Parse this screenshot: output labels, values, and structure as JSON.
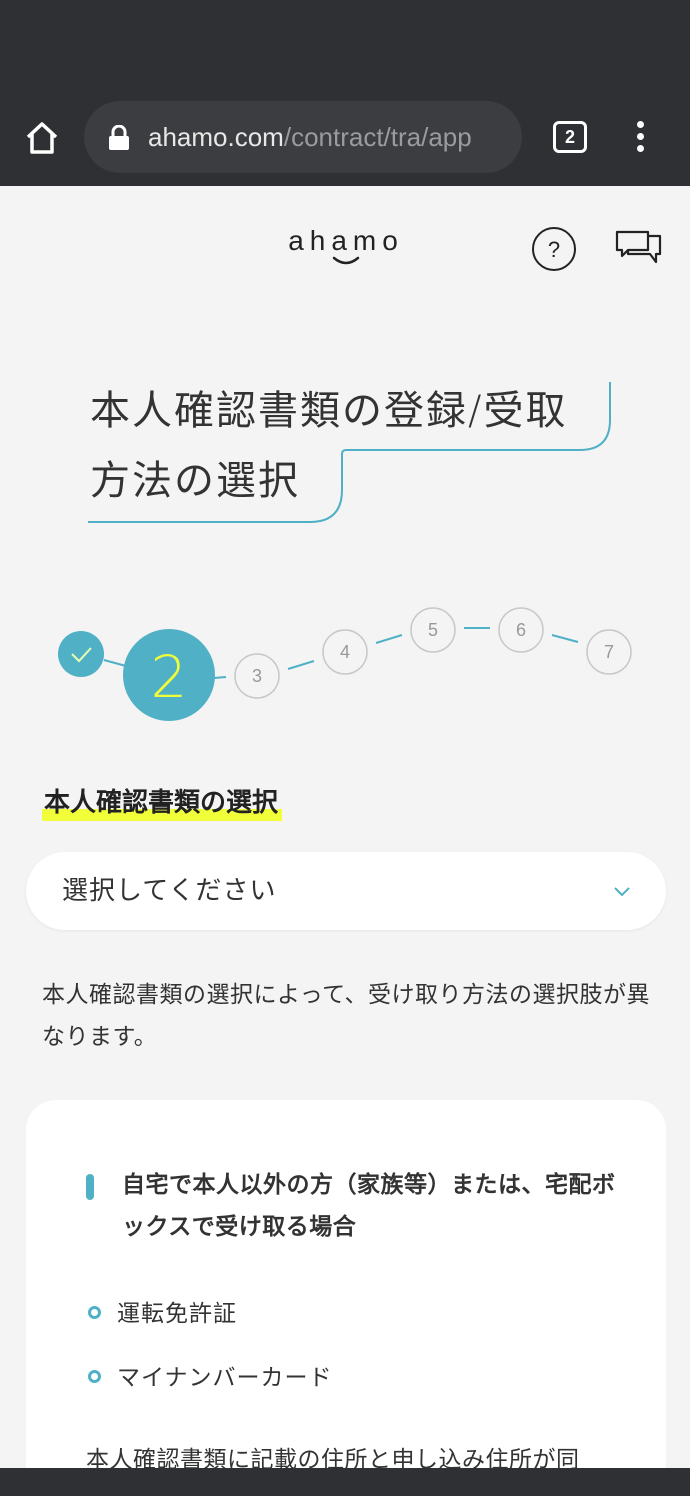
{
  "browser": {
    "url_host": "ahamo.com",
    "url_path": "/contract/tra/app",
    "tab_count": "2"
  },
  "header": {
    "logo": "ahamo",
    "help_label": "?"
  },
  "page": {
    "heading_line1": "本人確認書類の登録/受取",
    "heading_line2": "方法の選択"
  },
  "stepper": {
    "current": "2",
    "steps": [
      "3",
      "4",
      "5",
      "6",
      "7"
    ]
  },
  "section": {
    "title": "本人確認書類の選択",
    "select_placeholder": "選択してください",
    "note": "本人確認書類の選択によって、受け取り方法の選択肢が異なります。"
  },
  "card": {
    "title": "自宅で本人以外の方（家族等）または、宅配ボックスで受け取る場合",
    "items": [
      "運転免許証",
      "マイナンバーカード"
    ],
    "note": "本人確認書類に記載の住所と申し込み住所が同"
  },
  "colors": {
    "accent": "#4fb0c6",
    "highlight": "#f0ff3a",
    "chrome": "#2f3033"
  }
}
